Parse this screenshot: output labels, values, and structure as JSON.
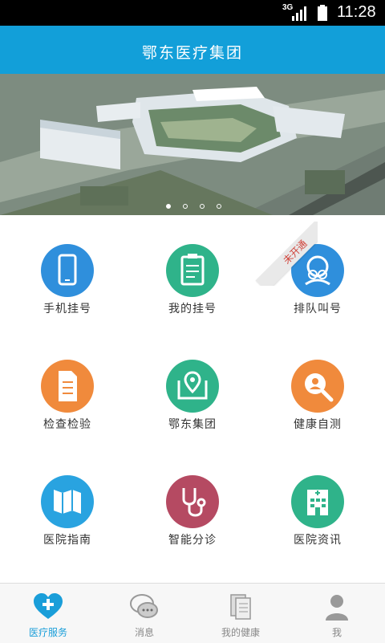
{
  "status_bar": {
    "network": "3G",
    "time": "11:28"
  },
  "header": {
    "title": "鄂东医疗集团"
  },
  "banner": {
    "slides": 4,
    "active_index": 0
  },
  "services": [
    {
      "label": "手机挂号",
      "icon": "phone-icon",
      "color": "#2f8fdc"
    },
    {
      "label": "我的挂号",
      "icon": "clipboard-icon",
      "color": "#2fb38a"
    },
    {
      "label": "排队叫号",
      "icon": "queue-people-icon",
      "color": "#2f8fdc",
      "badge": "未开通"
    },
    {
      "label": "检查检验",
      "icon": "document-icon",
      "color": "#f08a3c"
    },
    {
      "label": "鄂东集团",
      "icon": "map-pin-icon",
      "color": "#2fb38a"
    },
    {
      "label": "健康自测",
      "icon": "magnifier-person-icon",
      "color": "#f08a3c"
    },
    {
      "label": "医院指南",
      "icon": "map-icon",
      "color": "#29a3e0"
    },
    {
      "label": "智能分诊",
      "icon": "stethoscope-icon",
      "color": "#b54a62"
    },
    {
      "label": "医院资讯",
      "icon": "hospital-building-icon",
      "color": "#2fb38a"
    }
  ],
  "tabs": [
    {
      "label": "医疗服务",
      "icon": "heart-plus-icon",
      "active": true
    },
    {
      "label": "消息",
      "icon": "chat-bubbles-icon",
      "active": false
    },
    {
      "label": "我的健康",
      "icon": "documents-icon",
      "active": false
    },
    {
      "label": "我",
      "icon": "user-icon",
      "active": false
    }
  ],
  "accent_color": "#129fd9"
}
